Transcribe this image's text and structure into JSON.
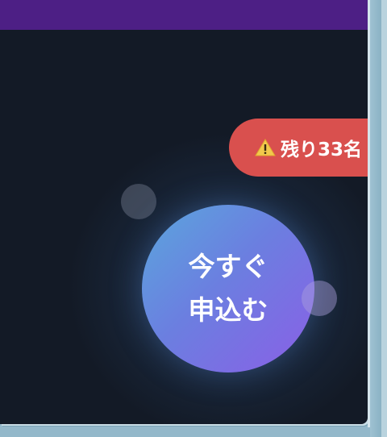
{
  "header": {
    "color": "#4d1f85"
  },
  "badge": {
    "icon": "warning-icon",
    "text": "残り33名",
    "color": "#d9504e"
  },
  "cta": {
    "line1": "今すぐ",
    "line2": "申込む"
  }
}
